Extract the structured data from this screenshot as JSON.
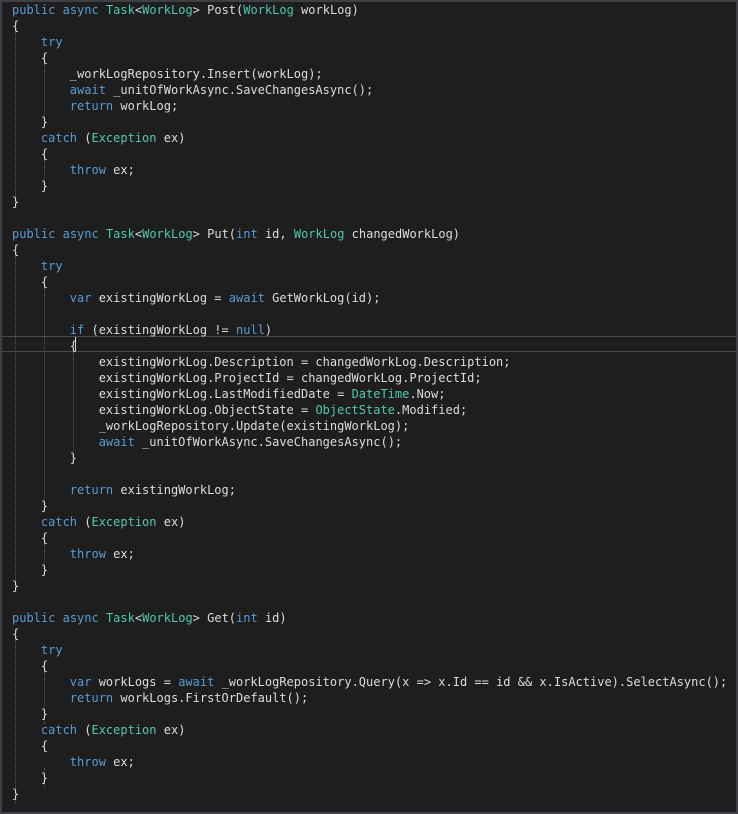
{
  "editor": {
    "theme": "dark",
    "colors": {
      "background": "#1e1e1e",
      "keyword": "#569cd6",
      "type": "#4ec9b0",
      "text": "#dcdcdc",
      "guide": "#5a5a5a"
    },
    "lines": [
      [
        [
          "kw",
          "public"
        ],
        [
          "tx",
          " "
        ],
        [
          "kw",
          "async"
        ],
        [
          "tx",
          " "
        ],
        [
          "ty",
          "Task"
        ],
        [
          "tx",
          "<"
        ],
        [
          "ty",
          "WorkLog"
        ],
        [
          "tx",
          "> Post("
        ],
        [
          "ty",
          "WorkLog"
        ],
        [
          "tx",
          " workLog)"
        ]
      ],
      [
        [
          "tx",
          "{"
        ]
      ],
      [
        [
          "tx",
          "    "
        ],
        [
          "kw",
          "try"
        ]
      ],
      [
        [
          "tx",
          "    {"
        ]
      ],
      [
        [
          "tx",
          "        _workLogRepository.Insert(workLog);"
        ]
      ],
      [
        [
          "tx",
          "        "
        ],
        [
          "kw",
          "await"
        ],
        [
          "tx",
          " _unitOfWorkAsync.SaveChangesAsync();"
        ]
      ],
      [
        [
          "tx",
          "        "
        ],
        [
          "kw",
          "return"
        ],
        [
          "tx",
          " workLog;"
        ]
      ],
      [
        [
          "tx",
          "    }"
        ]
      ],
      [
        [
          "tx",
          "    "
        ],
        [
          "kw",
          "catch"
        ],
        [
          "tx",
          " ("
        ],
        [
          "ty",
          "Exception"
        ],
        [
          "tx",
          " ex)"
        ]
      ],
      [
        [
          "tx",
          "    {"
        ]
      ],
      [
        [
          "tx",
          "        "
        ],
        [
          "kw",
          "throw"
        ],
        [
          "tx",
          " ex;"
        ]
      ],
      [
        [
          "tx",
          "    }"
        ]
      ],
      [
        [
          "tx",
          "}"
        ]
      ],
      [],
      [
        [
          "kw",
          "public"
        ],
        [
          "tx",
          " "
        ],
        [
          "kw",
          "async"
        ],
        [
          "tx",
          " "
        ],
        [
          "ty",
          "Task"
        ],
        [
          "tx",
          "<"
        ],
        [
          "ty",
          "WorkLog"
        ],
        [
          "tx",
          "> Put("
        ],
        [
          "kw",
          "int"
        ],
        [
          "tx",
          " id, "
        ],
        [
          "ty",
          "WorkLog"
        ],
        [
          "tx",
          " changedWorkLog)"
        ]
      ],
      [
        [
          "tx",
          "{"
        ]
      ],
      [
        [
          "tx",
          "    "
        ],
        [
          "kw",
          "try"
        ]
      ],
      [
        [
          "tx",
          "    {"
        ]
      ],
      [
        [
          "tx",
          "        "
        ],
        [
          "kw",
          "var"
        ],
        [
          "tx",
          " existingWorkLog = "
        ],
        [
          "kw",
          "await"
        ],
        [
          "tx",
          " GetWorkLog(id);"
        ]
      ],
      [],
      [
        [
          "tx",
          "        "
        ],
        [
          "kw",
          "if"
        ],
        [
          "tx",
          " (existingWorkLog != "
        ],
        [
          "kw",
          "null"
        ],
        [
          "tx",
          ")"
        ]
      ],
      [
        [
          "tx",
          "        {"
        ]
      ],
      [
        [
          "tx",
          "            existingWorkLog.Description = changedWorkLog.Description;"
        ]
      ],
      [
        [
          "tx",
          "            existingWorkLog.ProjectId = changedWorkLog.ProjectId;"
        ]
      ],
      [
        [
          "tx",
          "            existingWorkLog.LastModifiedDate = "
        ],
        [
          "ty",
          "DateTime"
        ],
        [
          "tx",
          ".Now;"
        ]
      ],
      [
        [
          "tx",
          "            existingWorkLog.ObjectState = "
        ],
        [
          "ty",
          "ObjectState"
        ],
        [
          "tx",
          ".Modified;"
        ]
      ],
      [
        [
          "tx",
          "            _workLogRepository.Update(existingWorkLog);"
        ]
      ],
      [
        [
          "tx",
          "            "
        ],
        [
          "kw",
          "await"
        ],
        [
          "tx",
          " _unitOfWorkAsync.SaveChangesAsync();"
        ]
      ],
      [
        [
          "tx",
          "        }"
        ]
      ],
      [],
      [
        [
          "tx",
          "        "
        ],
        [
          "kw",
          "return"
        ],
        [
          "tx",
          " existingWorkLog;"
        ]
      ],
      [
        [
          "tx",
          "    }"
        ]
      ],
      [
        [
          "tx",
          "    "
        ],
        [
          "kw",
          "catch"
        ],
        [
          "tx",
          " ("
        ],
        [
          "ty",
          "Exception"
        ],
        [
          "tx",
          " ex)"
        ]
      ],
      [
        [
          "tx",
          "    {"
        ]
      ],
      [
        [
          "tx",
          "        "
        ],
        [
          "kw",
          "throw"
        ],
        [
          "tx",
          " ex;"
        ]
      ],
      [
        [
          "tx",
          "    }"
        ]
      ],
      [
        [
          "tx",
          "}"
        ]
      ],
      [],
      [
        [
          "kw",
          "public"
        ],
        [
          "tx",
          " "
        ],
        [
          "kw",
          "async"
        ],
        [
          "tx",
          " "
        ],
        [
          "ty",
          "Task"
        ],
        [
          "tx",
          "<"
        ],
        [
          "ty",
          "WorkLog"
        ],
        [
          "tx",
          "> Get("
        ],
        [
          "kw",
          "int"
        ],
        [
          "tx",
          " id)"
        ]
      ],
      [
        [
          "tx",
          "{"
        ]
      ],
      [
        [
          "tx",
          "    "
        ],
        [
          "kw",
          "try"
        ]
      ],
      [
        [
          "tx",
          "    {"
        ]
      ],
      [
        [
          "tx",
          "        "
        ],
        [
          "kw",
          "var"
        ],
        [
          "tx",
          " workLogs = "
        ],
        [
          "kw",
          "await"
        ],
        [
          "tx",
          " _workLogRepository.Query(x => x.Id == id && x.IsActive).SelectAsync();"
        ]
      ],
      [
        [
          "tx",
          "        "
        ],
        [
          "kw",
          "return"
        ],
        [
          "tx",
          " workLogs.FirstOrDefault();"
        ]
      ],
      [
        [
          "tx",
          "    }"
        ]
      ],
      [
        [
          "tx",
          "    "
        ],
        [
          "kw",
          "catch"
        ],
        [
          "tx",
          " ("
        ],
        [
          "ty",
          "Exception"
        ],
        [
          "tx",
          " ex)"
        ]
      ],
      [
        [
          "tx",
          "    {"
        ]
      ],
      [
        [
          "tx",
          "        "
        ],
        [
          "kw",
          "throw"
        ],
        [
          "tx",
          " ex;"
        ]
      ],
      [
        [
          "tx",
          "    }"
        ]
      ],
      [
        [
          "tx",
          "}"
        ]
      ]
    ]
  }
}
